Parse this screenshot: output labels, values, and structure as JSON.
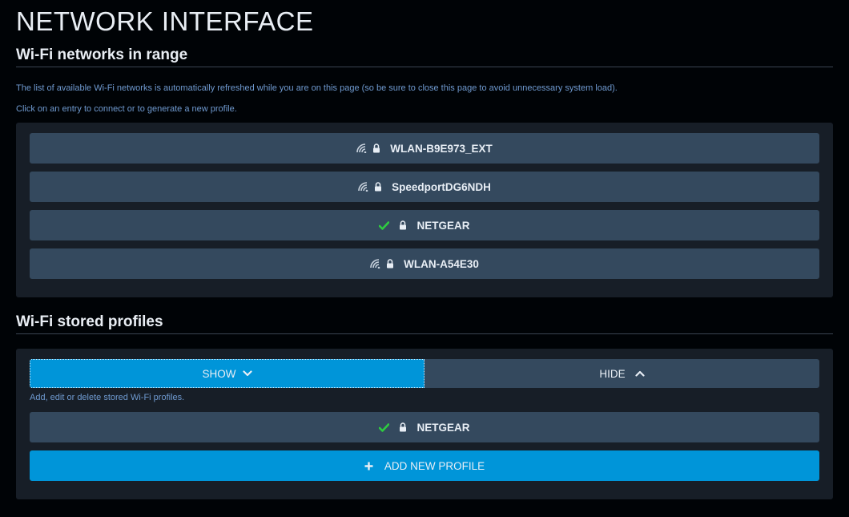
{
  "page": {
    "title": "NETWORK INTERFACE"
  },
  "networks": {
    "title": "Wi-Fi networks in range",
    "hint1": "The list of available Wi-Fi networks is automatically refreshed while you are on this page (so be sure to close this page to avoid unnecessary system load).",
    "hint2": "Click on an entry to connect or to generate a new profile.",
    "items": [
      {
        "ssid": "WLAN-B9E973_EXT",
        "status_icon": "wifi-signal-icon",
        "lock_icon": "lock-icon"
      },
      {
        "ssid": "SpeedportDG6NDH",
        "status_icon": "wifi-signal-icon",
        "lock_icon": "lock-icon"
      },
      {
        "ssid": "NETGEAR",
        "status_icon": "connected-check-icon",
        "lock_icon": "lock-icon"
      },
      {
        "ssid": "WLAN-A54E30",
        "status_icon": "wifi-signal-icon",
        "lock_icon": "lock-icon"
      }
    ]
  },
  "profiles": {
    "title": "Wi-Fi stored profiles",
    "show_label": "SHOW",
    "hide_label": "HIDE",
    "hint": "Add, edit or delete stored Wi-Fi profiles.",
    "items": [
      {
        "ssid": "NETGEAR",
        "status_icon": "connected-check-icon",
        "lock_icon": "lock-icon"
      }
    ],
    "add_label": "ADD NEW PROFILE"
  },
  "colors": {
    "accent": "#0095d9",
    "entry_bg": "#34495e",
    "panel_bg": "#171e27",
    "check": "#2ecc40",
    "hint_text": "#6f9ad0"
  }
}
